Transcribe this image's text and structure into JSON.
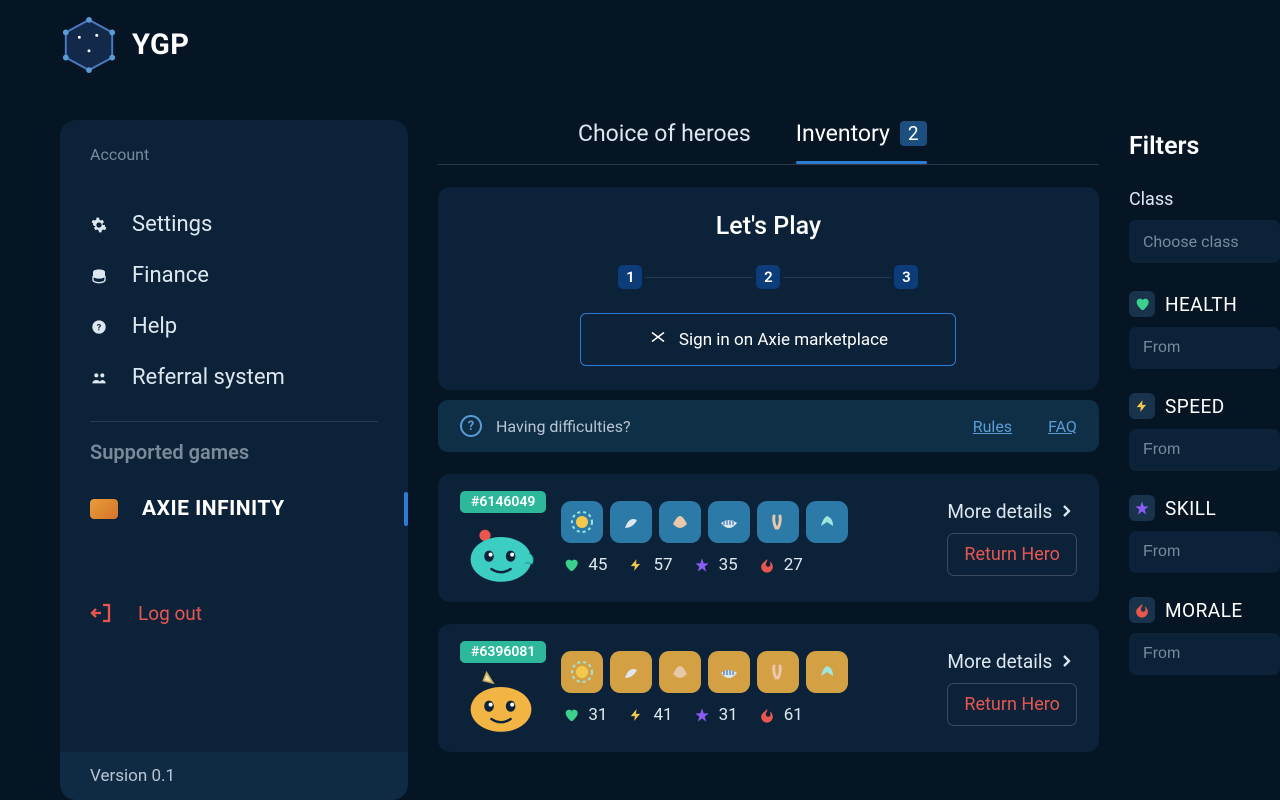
{
  "logo": {
    "text": "YGP"
  },
  "sidebar": {
    "account_label": "Account",
    "nav": [
      {
        "label": "Settings"
      },
      {
        "label": "Finance"
      },
      {
        "label": "Help"
      },
      {
        "label": "Referral system"
      }
    ],
    "supported_title": "Supported games",
    "game": {
      "name": "AXIE INFINITY"
    },
    "logout": "Log out",
    "version": "Version 0.1"
  },
  "tabs": {
    "choice": "Choice of heroes",
    "inventory": "Inventory",
    "inventory_count": "2"
  },
  "play": {
    "title": "Let's Play",
    "steps": [
      "1",
      "2",
      "3"
    ],
    "signin": "Sign in on Axie marketplace"
  },
  "diff": {
    "text": "Having difficulties?",
    "rules": "Rules",
    "faq": "FAQ"
  },
  "heroes": [
    {
      "id": "#6146049",
      "stats": {
        "health": "45",
        "speed": "57",
        "skill": "35",
        "morale": "27"
      },
      "palette": "blue",
      "tint": "#3CCEC3"
    },
    {
      "id": "#6396081",
      "stats": {
        "health": "31",
        "speed": "41",
        "skill": "31",
        "morale": "61"
      },
      "palette": "orange",
      "tint": "#F2B544"
    }
  ],
  "hero_actions": {
    "more": "More details",
    "return": "Return Hero"
  },
  "filters": {
    "title": "Filters",
    "class_label": "Class",
    "class_placeholder": "Choose class",
    "stats": [
      {
        "label": "HEALTH",
        "icon": "heart",
        "color": "#3BD18C"
      },
      {
        "label": "SPEED",
        "icon": "bolt",
        "color": "#F2C94C"
      },
      {
        "label": "SKILL",
        "icon": "star",
        "color": "#8B5CF6"
      },
      {
        "label": "MORALE",
        "icon": "fire",
        "color": "#E8564F"
      }
    ],
    "from_placeholder": "From"
  }
}
